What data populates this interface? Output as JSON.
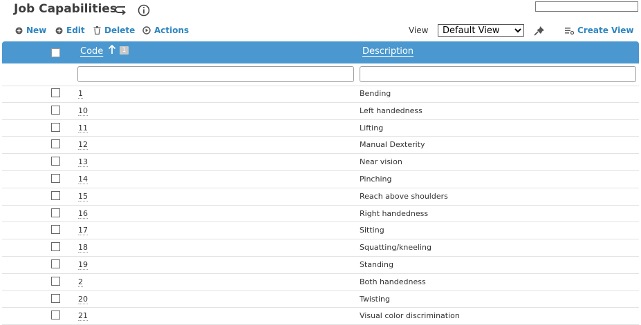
{
  "header": {
    "title": "Job Capabilities",
    "search": {
      "value": "",
      "placeholder": ""
    }
  },
  "toolbar": {
    "new_label": "New",
    "edit_label": "Edit",
    "delete_label": "Delete",
    "actions_label": "Actions",
    "view_label": "View",
    "view_selected": "Default View",
    "create_view_label": "Create View"
  },
  "grid": {
    "columns": {
      "code": "Code",
      "description": "Description",
      "sort_order_badge": "1"
    },
    "rows": [
      {
        "code": "1",
        "description": "Bending"
      },
      {
        "code": "10",
        "description": "Left handedness"
      },
      {
        "code": "11",
        "description": "Lifting"
      },
      {
        "code": "12",
        "description": "Manual Dexterity"
      },
      {
        "code": "13",
        "description": "Near vision"
      },
      {
        "code": "14",
        "description": "Pinching"
      },
      {
        "code": "15",
        "description": "Reach above shoulders"
      },
      {
        "code": "16",
        "description": "Right handedness"
      },
      {
        "code": "17",
        "description": "Sitting"
      },
      {
        "code": "18",
        "description": "Squatting/kneeling"
      },
      {
        "code": "19",
        "description": "Standing"
      },
      {
        "code": "2",
        "description": "Both handedness"
      },
      {
        "code": "20",
        "description": "Twisting"
      },
      {
        "code": "21",
        "description": "Visual color discrimination"
      }
    ]
  },
  "colors": {
    "accent": "#2e86c1",
    "header_bg": "#4a98cf"
  }
}
